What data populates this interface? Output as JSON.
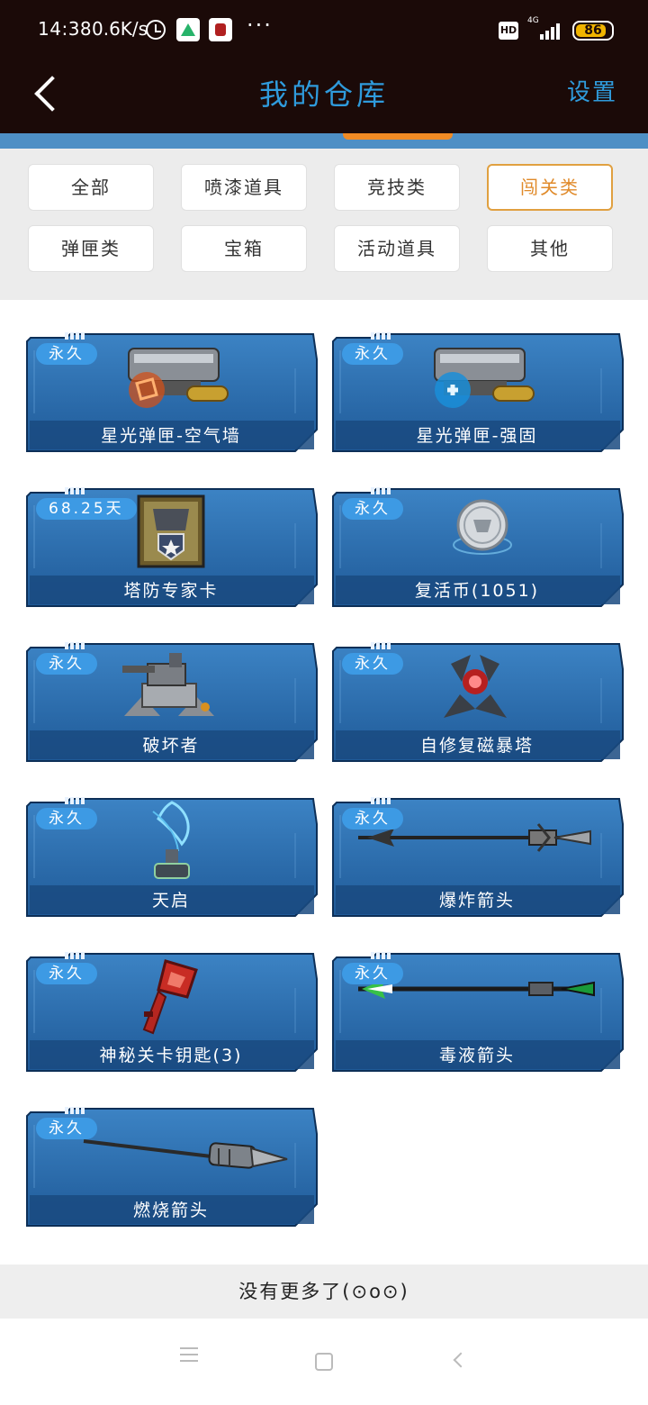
{
  "status_bar": {
    "time": "14:38",
    "net_speed": "0.6K/s",
    "network": "4G",
    "hd": "HD",
    "battery": "86",
    "battery_level": 0.86,
    "dots": "···"
  },
  "header": {
    "title": "我的仓库",
    "settings_label": "设置"
  },
  "filters": [
    {
      "label": "全部",
      "active": false
    },
    {
      "label": "喷漆道具",
      "active": false
    },
    {
      "label": "竞技类",
      "active": false
    },
    {
      "label": "闯关类",
      "active": true
    },
    {
      "label": "弹匣类",
      "active": false
    },
    {
      "label": "宝箱",
      "active": false
    },
    {
      "label": "活动道具",
      "active": false
    },
    {
      "label": "其他",
      "active": false
    }
  ],
  "items": [
    {
      "badge": "永久",
      "name": "星光弹匣-空气墙",
      "icon": "magazine-air-wall-icon"
    },
    {
      "badge": "永久",
      "name": "星光弹匣-强固",
      "icon": "magazine-reinforce-icon"
    },
    {
      "badge": "68.25天",
      "name": "塔防专家卡",
      "icon": "tower-defense-card-icon"
    },
    {
      "badge": "永久",
      "name": "复活币(1051)",
      "icon": "revive-coin-icon"
    },
    {
      "badge": "永久",
      "name": "破坏者",
      "icon": "destroyer-turret-icon"
    },
    {
      "badge": "永久",
      "name": "自修复磁暴塔",
      "icon": "tesla-tower-icon"
    },
    {
      "badge": "永久",
      "name": "天启",
      "icon": "apocalypse-tower-icon"
    },
    {
      "badge": "永久",
      "name": "爆炸箭头",
      "icon": "explosive-arrow-icon"
    },
    {
      "badge": "永久",
      "name": "神秘关卡钥匙(3)",
      "icon": "mystery-key-icon"
    },
    {
      "badge": "永久",
      "name": "毒液箭头",
      "icon": "venom-arrow-icon"
    },
    {
      "badge": "永久",
      "name": "燃烧箭头",
      "icon": "fire-arrow-icon"
    }
  ],
  "footer": {
    "no_more": "没有更多了(⊙o⊙)"
  },
  "colors": {
    "header_bg": "#1b0a08",
    "accent_blue": "#2f9bdc",
    "active_orange": "#e08a2a",
    "card_blue": "#2a6aa8"
  }
}
